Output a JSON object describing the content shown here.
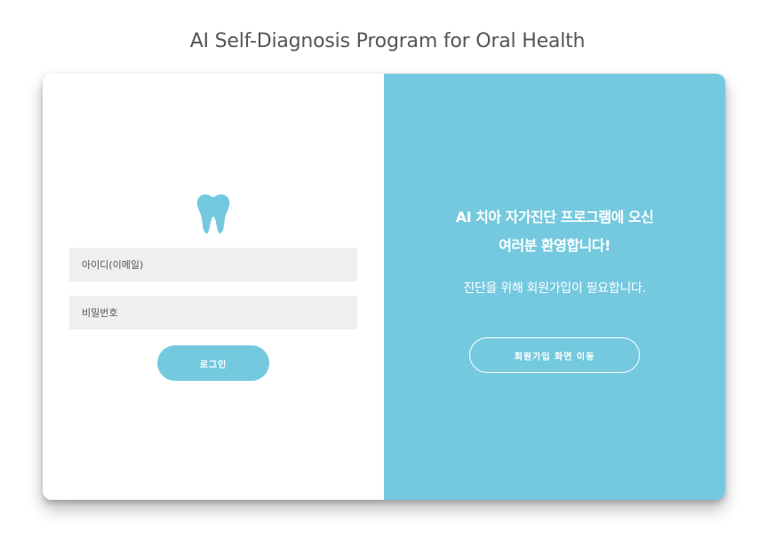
{
  "page": {
    "title": "AI Self-Diagnosis Program for Oral Health"
  },
  "login": {
    "icon": "tooth-icon",
    "id_placeholder": "아이디(이메일)",
    "id_value": "",
    "password_placeholder": "비밀번호",
    "password_value": "",
    "login_label": "로그인"
  },
  "welcome": {
    "line1": "AI 치아 자가진단 프로그램에 오신",
    "line2": "여러분 환영합니다!",
    "note": "진단을 위해 회원가입이 필요합니다.",
    "signup_label": "회원가입 화면 이동"
  },
  "colors": {
    "accent": "#74c9df",
    "field_bg": "#efefef",
    "title": "#555555"
  }
}
